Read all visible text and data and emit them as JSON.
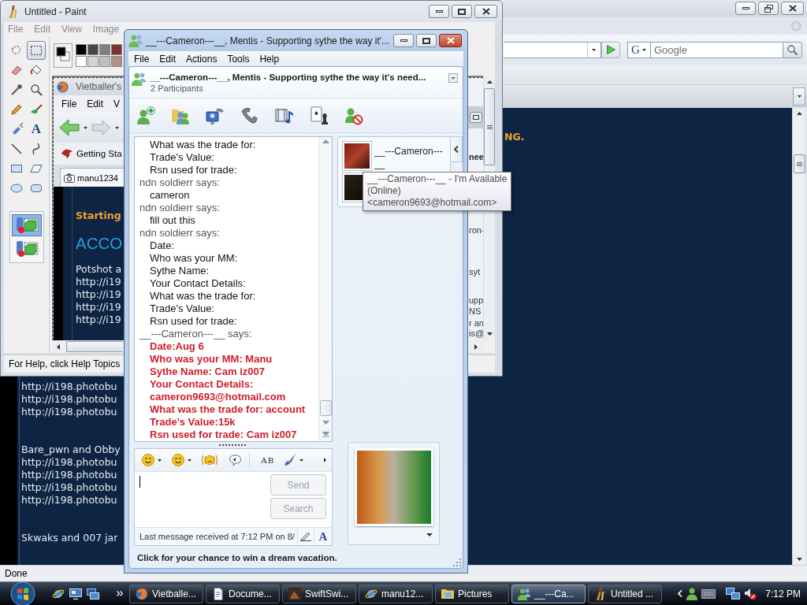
{
  "browser": {
    "active": false,
    "maximized": true,
    "search": {
      "engine_glyph": "G",
      "placeholder": "Google"
    },
    "page": {
      "heading_fragment": "NG.",
      "blocks": [
        {
          "lines": [
            "http://i198.photobu",
            "http://i198.photobu",
            "http://i198.photobu"
          ]
        },
        {
          "lines": [
            "Bare_pwn and Obby",
            "http://i198.photobu",
            "http://i198.photobu",
            "http://i198.photobu",
            "http://i198.photobu"
          ]
        },
        {
          "lines": [
            "Skwaks and 007 jar"
          ]
        }
      ]
    },
    "status": "Done"
  },
  "paint": {
    "active": false,
    "maximized": false,
    "title": "Untitled - Paint",
    "menu": [
      "File",
      "Edit",
      "View",
      "Image"
    ],
    "tools": [
      {
        "selected": false
      },
      {
        "selected": true
      },
      {
        "selected": false
      },
      {
        "selected": false
      },
      {
        "selected": false
      },
      {
        "selected": false
      },
      {
        "selected": false
      },
      {
        "selected": false
      },
      {
        "selected": false
      },
      {
        "selected": false,
        "glyph": "A"
      },
      {
        "selected": false
      },
      {
        "selected": false
      },
      {
        "selected": false
      },
      {
        "selected": false
      },
      {
        "selected": false
      },
      {
        "selected": false
      }
    ],
    "tool_options": [
      {
        "selected": true
      },
      {
        "selected": false
      }
    ],
    "palette": [
      {
        "color": "#000000"
      },
      {
        "color": "#404850"
      },
      {
        "color": "#808080"
      },
      {
        "color": "#803030"
      },
      {
        "color": "#ffffff"
      },
      {
        "color": "#d4d4d4"
      },
      {
        "color": "#c0c0c0"
      },
      {
        "color": "#b09080"
      }
    ],
    "canvas_image": {
      "window_title": "Vietballer's",
      "menu": [
        "File",
        "Edit",
        "V"
      ],
      "bookmark": "Getting Sta",
      "tab": "manu1234",
      "page": {
        "heading": "Starting",
        "title": "ACCO",
        "lines": [
          "Potshot a",
          "http://i19",
          "http://i19",
          "http://i19",
          "http://i19"
        ]
      },
      "right_fragments": [
        "nee",
        "ron-",
        "syt",
        "upp",
        "NS",
        "r an",
        "is@"
      ]
    },
    "status": "For Help, click Help Topics"
  },
  "messenger": {
    "active": true,
    "maximized": false,
    "title": "__---Cameron---__, Mentis - Supporting sythe the way it'...",
    "menu": [
      "File",
      "Edit",
      "Actions",
      "Tools",
      "Help"
    ],
    "conversation_title": "__---Cameron---__, Mentis - Supporting sythe the way it's need...",
    "participants": "2 Participants",
    "messages": [
      {
        "kind": "plain",
        "lines": [
          "What was the trade for:",
          "Trade's Value:",
          "Rsn used for trade:"
        ]
      },
      {
        "kind": "plain",
        "sender": "ndn soldierr says:",
        "lines": [
          "cameron"
        ]
      },
      {
        "kind": "plain",
        "sender": "ndn soldierr says:",
        "lines": [
          "fill out this"
        ]
      },
      {
        "kind": "plain",
        "sender": "ndn soldierr says:",
        "lines": [
          "Date:",
          "Who was your MM:",
          "Sythe Name:",
          "Your Contact Details:",
          "What was the trade for:",
          "Trade's Value:",
          "Rsn used for trade:"
        ]
      },
      {
        "kind": "formatted",
        "sender": "__---Cameron---__ says:",
        "lines": [
          "Date:Aug 6",
          "Who was your MM: Manu",
          "Sythe Name: Cam iz007",
          "Your Contact Details:",
          "cameron9693@hotmail.com",
          "What was the trade for: account",
          "Trade's Value:15k",
          "Rsn used for trade: Cam iz007"
        ]
      }
    ],
    "contacts": [
      {
        "name": "__---Cameron---__"
      }
    ],
    "tooltip": [
      "__---Cameron---__ - I'm Available",
      "(Online)",
      "<cameron9693@hotmail.com>"
    ],
    "format_glyph": "AB",
    "buttons": [
      {
        "label": "Send",
        "disabled": true
      },
      {
        "label": "Search",
        "disabled": true
      }
    ],
    "status": "Last message received at 7:12 PM on 8/",
    "font_color_glyph": "A",
    "ad": "Click for your chance to win a dream vacation."
  },
  "taskbar": {
    "buttons": [
      {
        "label": "Vietballe...",
        "selected": false
      },
      {
        "label": "Docume...",
        "selected": false
      },
      {
        "label": "SwiftSwi...",
        "selected": false
      },
      {
        "label": "manu12...",
        "selected": false
      },
      {
        "label": "Pictures",
        "selected": false
      },
      {
        "label": "__---Ca...",
        "selected": true
      },
      {
        "label": "Untitled ...",
        "selected": false
      }
    ],
    "clock": "7:12 PM"
  }
}
